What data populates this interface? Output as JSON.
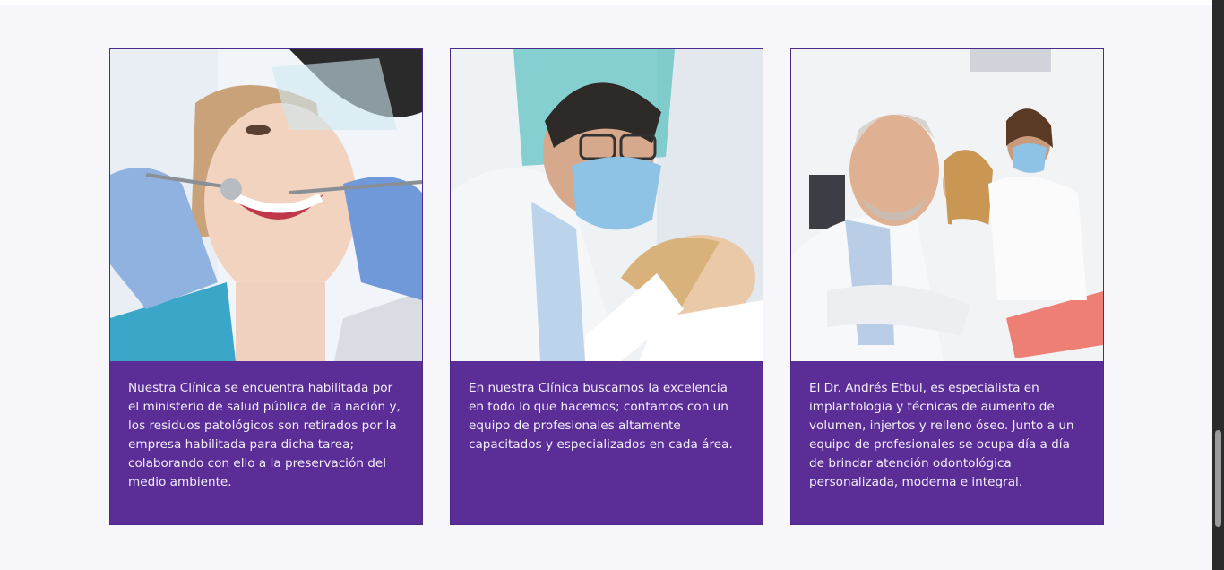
{
  "cards": [
    {
      "photo": "dentist-examining-smiling-woman-photo",
      "text": "Nuestra Clínica se encuentra habilitada por el ministerio de salud pública de la nación y, los residuos patológicos son retirados por la empresa habilitada para dicha tarea; colaborando con ello a la preservación del medio ambiente."
    },
    {
      "photo": "masked-dentist-treating-patient-photo",
      "text": "En nuestra Clínica buscamos la excelencia en todo lo que hacemos; contamos con un equipo de profesionales altamente capacitados y especializados en cada área."
    },
    {
      "photo": "doctor-and-assistant-with-patient-photo",
      "text": "El Dr. Andrés Etbul, es especialista en implantologia y técnicas de aumento de volumen, injertos y relleno óseo. Junto a un equipo de profesionales se ocupa día a día de brindar atención odontológica personalizada, moderna e integral."
    }
  ],
  "colors": {
    "card_background": "#5b2d96",
    "card_border": "#4a2a8c",
    "section_background": "#f7f6fb",
    "card_text": "#f3eefc"
  }
}
